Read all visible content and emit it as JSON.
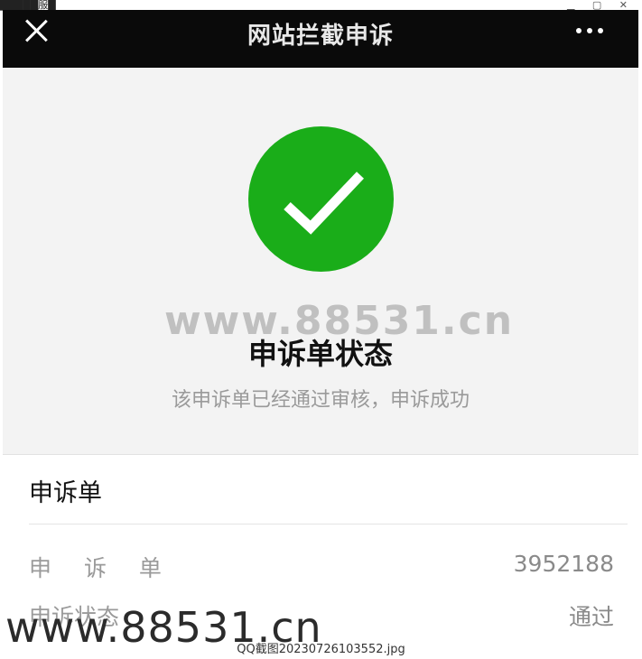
{
  "window": {
    "strip_text": "█████服█",
    "controls": "▁ ▢ ✕"
  },
  "navbar": {
    "title": "网站拦截申诉",
    "close_icon": "close-icon",
    "more_icon": "more-icon"
  },
  "status": {
    "icon": "check-icon",
    "title": "申诉单状态",
    "description": "该申诉单已经通过审核，申诉成功",
    "accent_color": "#1aad19"
  },
  "card": {
    "header": "申诉单",
    "rows": [
      {
        "label": "申 诉 单",
        "value": "3952188"
      },
      {
        "label": "申诉状态",
        "value": "通过"
      }
    ]
  },
  "watermarks": {
    "center": "www.88531.cn",
    "bottom": "www.88531.cn"
  },
  "caption": "QQ截图20230726103552.jpg"
}
